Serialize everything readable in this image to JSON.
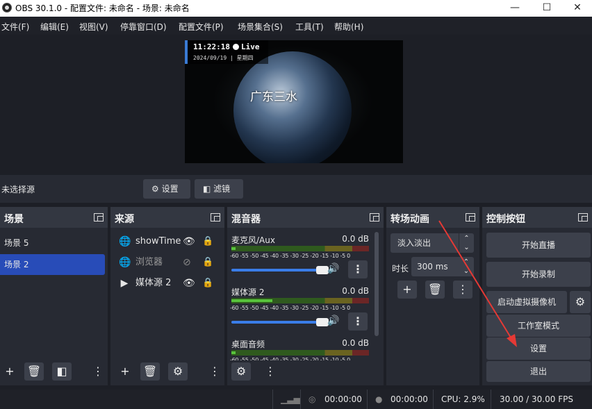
{
  "window": {
    "title": "OBS 30.1.0 - 配置文件: 未命名 - 场景: 未命名",
    "minimize": "—",
    "maximize": "☐",
    "close": "✕"
  },
  "menu": [
    "文件(F)",
    "编辑(E)",
    "视图(V)",
    "停靠窗口(D)",
    "配置文件(P)",
    "场景集合(S)",
    "工具(T)",
    "帮助(H)"
  ],
  "preview": {
    "clock": "11:22:18",
    "live": "Live",
    "date": "2024/09/19 | 星期四",
    "caption": "广东三水"
  },
  "source_bar": {
    "no_selection": "未选择源",
    "settings": "设置",
    "filters": "滤镜"
  },
  "docks": {
    "scenes": {
      "title": "场景",
      "items": [
        "场景 5",
        "场景 2"
      ],
      "selected_index": 1
    },
    "sources": {
      "title": "来源",
      "items": [
        {
          "label": "showTime",
          "icon": "globe-icon",
          "visible": true
        },
        {
          "label": "浏览器",
          "icon": "globe-icon",
          "visible": false
        },
        {
          "label": "媒体源 2",
          "icon": "play-icon",
          "visible": true
        }
      ]
    },
    "mixer": {
      "title": "混音器",
      "ticks": "-60 -55 -50 -45 -40 -35 -30 -25 -20 -15 -10 -5  0",
      "channels": [
        {
          "name": "麦克风/Aux",
          "db": "0.0 dB",
          "level": 0.03
        },
        {
          "name": "媒体源 2",
          "db": "0.0 dB",
          "level": 0.3
        },
        {
          "name": "桌面音频",
          "db": "0.0 dB",
          "level": 0.03
        }
      ]
    },
    "transitions": {
      "title": "转场动画",
      "selected": "淡入淡出",
      "duration_label": "时长",
      "duration_value": "300 ms"
    },
    "controls": {
      "title": "控制按钮",
      "start_stream": "开始直播",
      "start_record": "开始录制",
      "virtual_cam": "启动虚拟摄像机",
      "studio_mode": "工作室模式",
      "settings": "设置",
      "exit": "退出"
    }
  },
  "status": {
    "stream_time": "00:00:00",
    "record_time": "00:00:00",
    "cpu": "CPU: 2.9%",
    "fps": "30.00 / 30.00 FPS"
  },
  "colors": {
    "selection": "#284cb8",
    "annotation_arrow": "#e53935",
    "volume_slider": "#3a7de8"
  }
}
